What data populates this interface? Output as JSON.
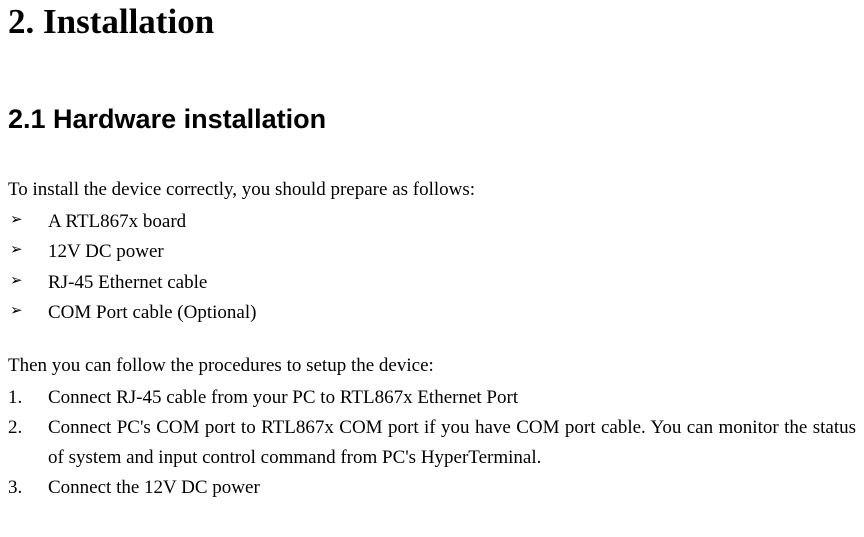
{
  "heading1": "2. Installation",
  "heading2": "2.1 Hardware installation",
  "intro": "To install the device correctly, you should prepare as follows:",
  "bullets": {
    "marker": "➢",
    "items": [
      "A RTL867x board",
      "12V DC power",
      "RJ-45 Ethernet cable",
      "COM Port cable (Optional)"
    ]
  },
  "then": "Then you can follow the procedures to setup the device:",
  "steps": [
    {
      "num": "1.",
      "text": "Connect RJ-45 cable from your PC to RTL867x Ethernet Port"
    },
    {
      "num": "2.",
      "text": "Connect PC's COM port to RTL867x COM port if you have COM port cable. You can monitor the status of system and input control command from PC's HyperTerminal."
    },
    {
      "num": "3.",
      "text": "Connect the 12V DC power"
    }
  ]
}
